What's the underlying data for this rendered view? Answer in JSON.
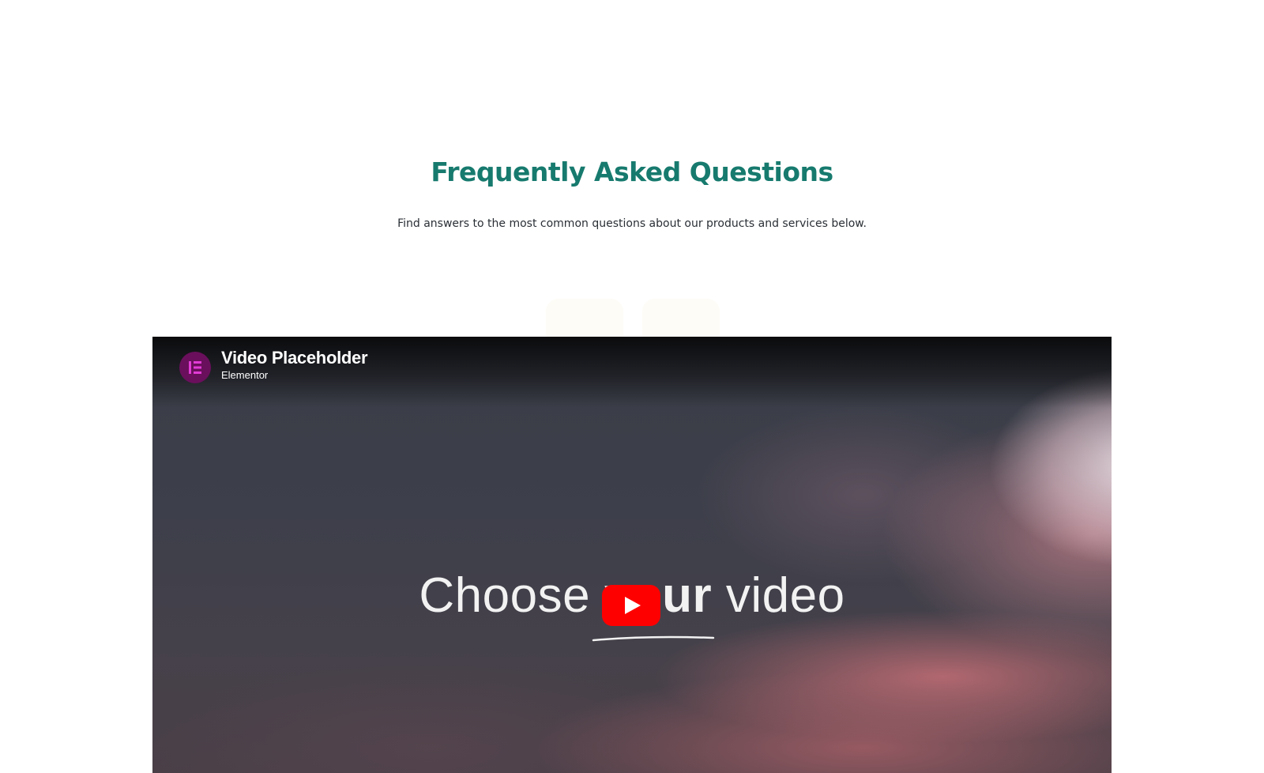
{
  "faq": {
    "title": "Frequently Asked Questions",
    "subtitle": "Find answers to the most common questions about our products and services below."
  },
  "video": {
    "title": "Video Placeholder",
    "channel": "Elementor",
    "overlay_text_left": "Choose ",
    "overlay_text_bold": "your",
    "overlay_text_right": " video",
    "play_icon": "youtube-play-icon",
    "avatar_icon": "elementor-logo-icon"
  },
  "colors": {
    "title": "#177a6e",
    "youtube_red": "#ff0000",
    "avatar_bg": "#6a0f5c",
    "avatar_logo": "#e23bd6"
  }
}
